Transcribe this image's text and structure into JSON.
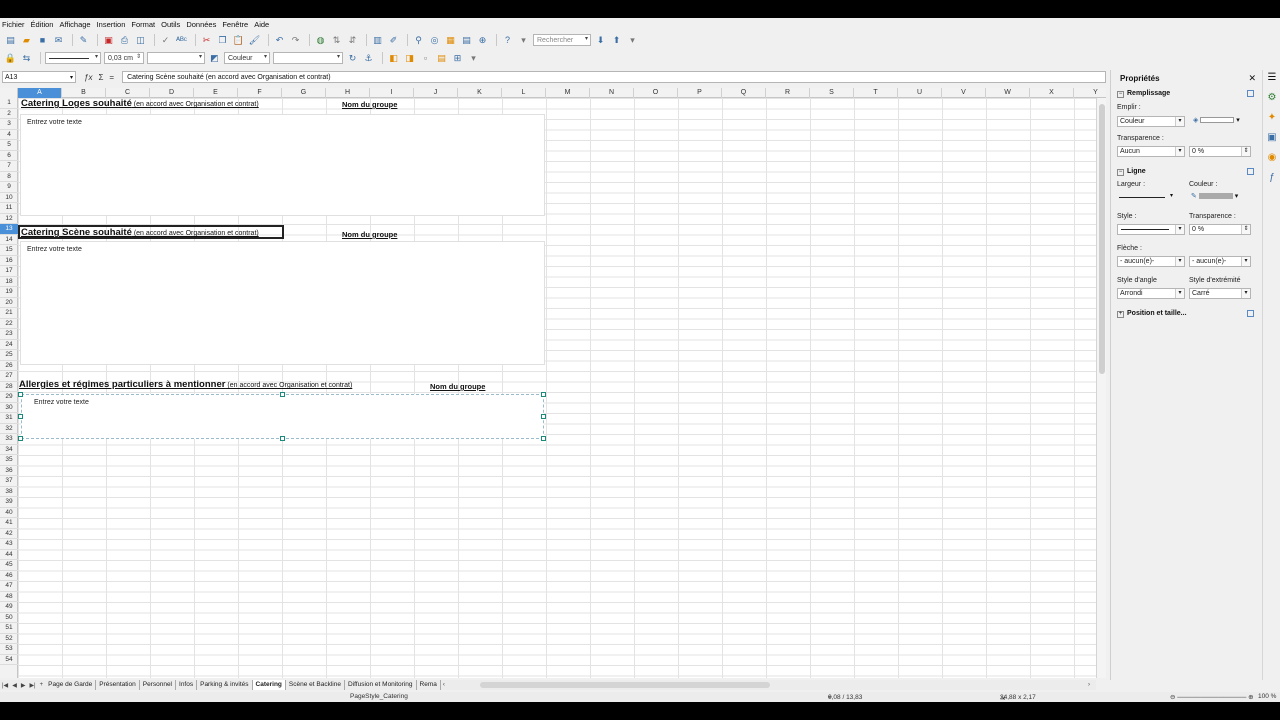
{
  "menu": [
    "Fichier",
    "Édition",
    "Affichage",
    "Insertion",
    "Format",
    "Outils",
    "Données",
    "Fenêtre",
    "Aide"
  ],
  "toolbar": {
    "search_placeholder": "Rechercher",
    "line_width": "0,03 cm",
    "area_style": "Couleur"
  },
  "formula": {
    "name_box": "A13",
    "content": "Catering Scène souhaité (en accord avec Organisation et contrat)"
  },
  "columns": [
    "A",
    "B",
    "C",
    "D",
    "E",
    "F",
    "G",
    "H",
    "I",
    "J",
    "K",
    "L",
    "M",
    "N",
    "O",
    "P",
    "Q",
    "R",
    "S",
    "T",
    "U",
    "V",
    "W",
    "X",
    "Y"
  ],
  "rows": [
    "1",
    "2",
    "3",
    "4",
    "5",
    "6",
    "7",
    "8",
    "9",
    "10",
    "11",
    "12",
    "13",
    "14",
    "15",
    "16",
    "17",
    "18",
    "19",
    "20",
    "21",
    "22",
    "23",
    "24",
    "25",
    "26",
    "27",
    "28",
    "29",
    "30",
    "31",
    "32",
    "33",
    "34",
    "35",
    "36",
    "37",
    "38",
    "39",
    "40",
    "41",
    "42",
    "43",
    "44",
    "45",
    "46",
    "47",
    "48",
    "49",
    "50",
    "51",
    "52",
    "53",
    "54"
  ],
  "sections": [
    {
      "title": "Catering Loges souhaité",
      "note": " (en accord avec Organisation et contrat)",
      "group": "Nom du groupe",
      "placeholder": "Entrez votre texte"
    },
    {
      "title": "Catering Scène souhaité",
      "note": " (en accord avec Organisation et contrat)",
      "group": "Nom du groupe",
      "placeholder": "Entrez votre texte"
    },
    {
      "title": "Allergies et régimes particuliers à mentionner",
      "note": " (en accord avec Organisation et contrat)",
      "group": "Nom du groupe",
      "placeholder": "Entrez votre texte"
    }
  ],
  "sheet_tabs": [
    "Page de Garde",
    "Présentation",
    "Personnel",
    "Infos",
    "Parking & invités",
    "Catering",
    "Scène et Backline",
    "Diffusion et Monitoring",
    "Rema"
  ],
  "active_tab": "Catering",
  "status": {
    "page_style": "PageStyle_Catering",
    "position": "0,08 / 13,83",
    "size": "24,88 x 2,17",
    "zoom": "100 %"
  },
  "sidebar": {
    "title": "Propriétés",
    "fill_section": "Remplissage",
    "fill_label": "Emplir :",
    "fill_value": "Couleur",
    "transparency_label": "Transparence :",
    "transparency_value": "Aucun",
    "transparency_pct": "0 %",
    "line_section": "Ligne",
    "width_label": "Largeur :",
    "color_label": "Couleur :",
    "style_label": "Style :",
    "line_transparency_label": "Transparence :",
    "line_transparency_value": "0 %",
    "arrow_label": "Flèche :",
    "arrow_start": "- aucun(e)-",
    "arrow_end": "- aucun(e)-",
    "corner_label": "Style d'angle",
    "corner_value": "Arrondi",
    "cap_label": "Style d'extrémité",
    "cap_value": "Carré",
    "position_section": "Position et taille..."
  }
}
